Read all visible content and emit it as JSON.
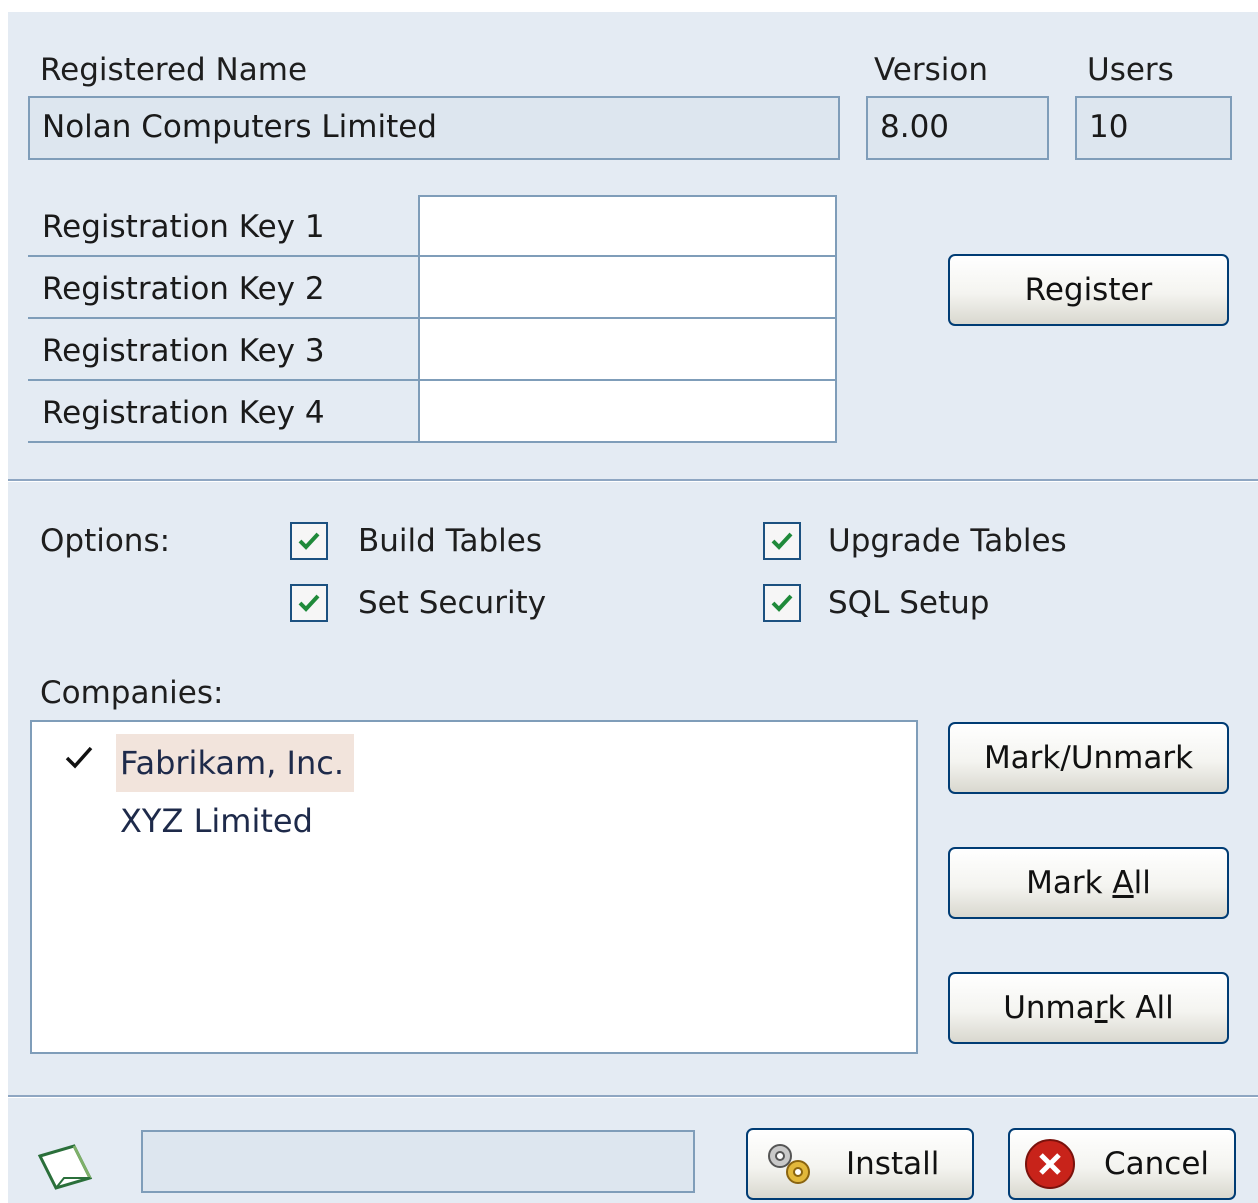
{
  "header": {
    "registered_name_label": "Registered Name",
    "registered_name_value": "Nolan Computers Limited",
    "version_label": "Version",
    "version_value": "8.00",
    "users_label": "Users",
    "users_value": "10"
  },
  "registration": {
    "keys": [
      {
        "label": "Registration Key 1",
        "value": ""
      },
      {
        "label": "Registration Key 2",
        "value": ""
      },
      {
        "label": "Registration Key 3",
        "value": ""
      },
      {
        "label": "Registration Key 4",
        "value": ""
      }
    ],
    "register_button": "Register"
  },
  "options": {
    "label": "Options:",
    "build_tables": {
      "label": "Build Tables",
      "checked": true
    },
    "upgrade_tables": {
      "label": "Upgrade Tables",
      "checked": true
    },
    "set_security": {
      "label": "Set Security",
      "checked": true
    },
    "sql_setup": {
      "label": "SQL Setup",
      "checked": true
    }
  },
  "companies": {
    "label": "Companies:",
    "items": [
      {
        "name": "Fabrikam, Inc.",
        "marked": true,
        "selected": true
      },
      {
        "name": "XYZ Limited",
        "marked": false,
        "selected": false
      }
    ],
    "mark_unmark_button": "Mark/Unmark",
    "mark_all_button_pre": "Mark ",
    "mark_all_button_access": "A",
    "mark_all_button_post": "ll",
    "unmark_all_button_pre": "Unma",
    "unmark_all_button_access": "r",
    "unmark_all_button_post": "k All"
  },
  "footer": {
    "status_text": "",
    "install_button": "Install",
    "cancel_button": "Cancel"
  },
  "colors": {
    "dialog_bg": "#e4ebf3",
    "field_border": "#7f9db9",
    "button_border": "#003c74",
    "checkmark": "#1f8a3a",
    "cancel_red": "#c8231a"
  }
}
